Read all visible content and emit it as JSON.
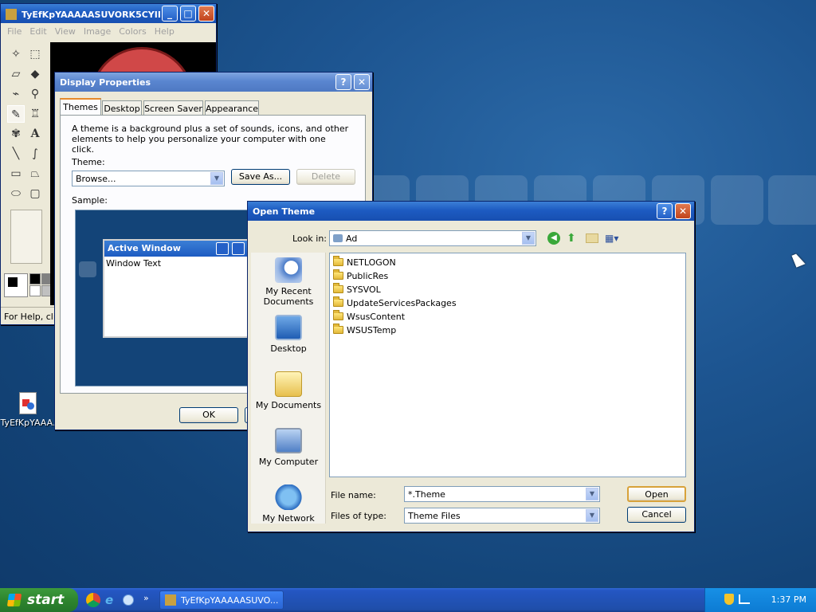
{
  "colors": {
    "desktop": "#134478",
    "title_active": "#1d5bc2",
    "window_bg": "#ece9d8",
    "taskbar": "#2456c3",
    "tray": "#0d7bd3",
    "start": "#2e852e"
  },
  "paint": {
    "title": "TyEfKpYAAAAASUVORK5CYII...",
    "menu": [
      "File",
      "Edit",
      "View",
      "Image",
      "Colors",
      "Help"
    ],
    "status": "For Help, clic",
    "tools": [
      "select-free-icon",
      "select-rect-icon",
      "eraser-icon",
      "fill-icon",
      "eyedropper-icon",
      "magnifier-icon",
      "pencil-icon",
      "brush-icon",
      "airbrush-icon",
      "text-icon",
      "line-icon",
      "curve-icon",
      "rectangle-icon",
      "polygon-icon",
      "ellipse-icon",
      "rounded-rect-icon"
    ]
  },
  "display": {
    "title": "Display Properties",
    "tabs": [
      "Themes",
      "Desktop",
      "Screen Saver",
      "Appearance"
    ],
    "description": "A theme is a background plus a set of sounds, icons, and other elements to help you personalize your computer with one click.",
    "theme_label": "Theme:",
    "theme_value": "Browse...",
    "save_as": "Save As...",
    "delete": "Delete",
    "sample_label": "Sample:",
    "active_window": "Active Window",
    "window_text": "Window Text",
    "ok": "OK"
  },
  "open_theme": {
    "title": "Open Theme",
    "look_in_label": "Look in:",
    "look_in_value": "Ad",
    "places": [
      "My Recent Documents",
      "Desktop",
      "My Documents",
      "My Computer",
      "My Network"
    ],
    "folders": [
      "NETLOGON",
      "PublicRes",
      "SYSVOL",
      "UpdateServicesPackages",
      "WsusContent",
      "WSUSTemp"
    ],
    "file_name_label": "File name:",
    "file_name_value": "*.Theme",
    "files_of_type_label": "Files of type:",
    "files_of_type_value": "Theme Files",
    "open": "Open",
    "cancel": "Cancel"
  },
  "desktop_icon": {
    "label": "TyEfKpYAAA."
  },
  "taskbar": {
    "start": "start",
    "task": "TyEfKpYAAAAASUVO...",
    "clock": "1:37 PM"
  }
}
